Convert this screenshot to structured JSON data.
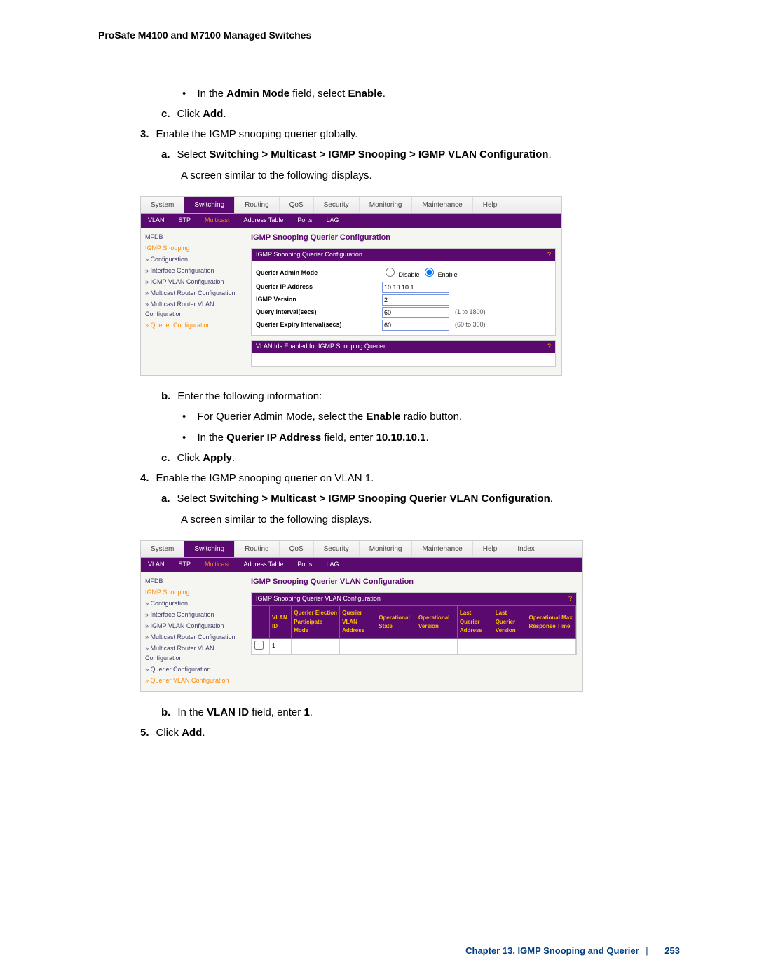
{
  "header": "ProSafe M4100 and M7100 Managed Switches",
  "body": {
    "bullet_admin_mode_prefix": "In the ",
    "bullet_admin_mode_field": "Admin Mode",
    "bullet_admin_mode_mid": " field, select ",
    "bullet_admin_mode_value": "Enable",
    "step_c": "c.",
    "step_c_text1": "Click ",
    "step_c_text_bold": "Add",
    "step3_num": "3.",
    "step3_text": "Enable the IGMP snooping querier globally.",
    "step3a_alpha": "a.",
    "step3a_prefix": "Select ",
    "step3a_bold": "Switching > Multicast > IGMP Snooping > IGMP VLAN Configuration",
    "step3a_after": "A screen similar to the following displays.",
    "step3b_alpha": "b.",
    "step3b_text": "Enter the following information:",
    "bullet_qam_prefix": "For Querier Admin Mode, select the ",
    "bullet_qam_bold": "Enable",
    "bullet_qam_suffix": " radio button.",
    "bullet_qip_prefix": "In the ",
    "bullet_qip_bold1": "Querier IP Address",
    "bullet_qip_mid": " field, enter ",
    "bullet_qip_bold2": "10.10.10.1",
    "step3c_alpha": "c.",
    "step3c_prefix": "Click ",
    "step3c_bold": "Apply",
    "step4_num": "4.",
    "step4_text": "Enable the IGMP snooping querier on VLAN 1.",
    "step4a_alpha": "a.",
    "step4a_prefix": "Select ",
    "step4a_bold": "Switching > Multicast > IGMP Snooping Querier VLAN Configuration",
    "step4a_after": "A screen similar to the following displays.",
    "step4b_alpha": "b.",
    "step4b_prefix": "In the ",
    "step4b_bold": "VLAN ID",
    "step4b_mid": " field, enter ",
    "step4b_val": "1",
    "step5_num": "5.",
    "step5_prefix": "Click ",
    "step5_bold": "Add"
  },
  "shot1": {
    "tabs": [
      "System",
      "Switching",
      "Routing",
      "QoS",
      "Security",
      "Monitoring",
      "Maintenance",
      "Help"
    ],
    "active_tab": "Switching",
    "subtabs": [
      "VLAN",
      "STP",
      "Multicast",
      "Address Table",
      "Ports",
      "LAG"
    ],
    "subtab_sel": "Multicast",
    "side": [
      "MFDB",
      "IGMP Snooping",
      "» Configuration",
      "» Interface Configuration",
      "» IGMP VLAN Configuration",
      "» Multicast Router Configuration",
      "» Multicast Router VLAN Configuration",
      "» Querier Configuration"
    ],
    "title": "IGMP Snooping Querier Configuration",
    "panel1": "IGMP Snooping Querier Configuration",
    "rows": {
      "admin_mode": "Querier Admin Mode",
      "admin_mode_opts": [
        "Disable",
        "Enable"
      ],
      "ip_label": "Querier IP Address",
      "ip_val": "10.10.10.1",
      "ver_label": "IGMP Version",
      "ver_val": "2",
      "int_label": "Query Interval(secs)",
      "int_val": "60",
      "int_hint": "(1 to 1800)",
      "exp_label": "Querier Expiry Interval(secs)",
      "exp_val": "60",
      "exp_hint": "(60 to 300)"
    },
    "panel2": "VLAN Ids Enabled for IGMP Snooping Querier"
  },
  "shot2": {
    "tabs": [
      "System",
      "Switching",
      "Routing",
      "QoS",
      "Security",
      "Monitoring",
      "Maintenance",
      "Help",
      "Index"
    ],
    "active_tab": "Switching",
    "subtabs": [
      "VLAN",
      "STP",
      "Multicast",
      "Address Table",
      "Ports",
      "LAG"
    ],
    "subtab_sel": "Multicast",
    "side": [
      "MFDB",
      "IGMP Snooping",
      "» Configuration",
      "» Interface Configuration",
      "» IGMP VLAN Configuration",
      "» Multicast Router Configuration",
      "» Multicast Router VLAN Configuration",
      "» Querier Configuration",
      "» Querier VLAN Configuration"
    ],
    "title": "IGMP Snooping Querier VLAN Configuration",
    "panel": "IGMP Snooping Querier VLAN Configuration",
    "cols": [
      "",
      "VLAN ID",
      "Querier Election Participate Mode",
      "Querier VLAN Address",
      "Operational State",
      "Operational Version",
      "Last Querier Address",
      "Last Querier Version",
      "Operational Max Response Time"
    ],
    "row_vlan": "1"
  },
  "footer": {
    "chapter": "Chapter 13. IGMP Snooping and Querier",
    "page": "253"
  }
}
